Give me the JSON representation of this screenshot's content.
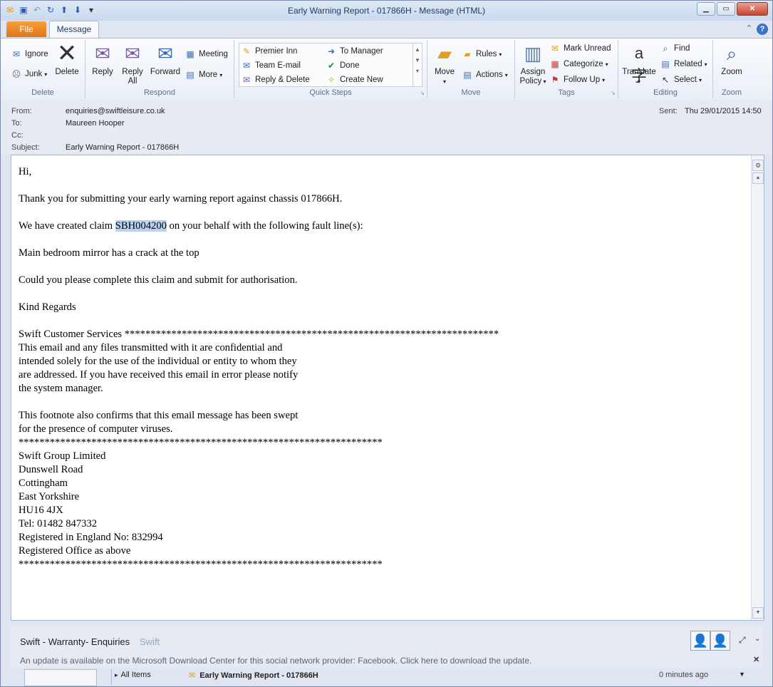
{
  "window": {
    "title": "Early Warning Report - 017866H  -  Message (HTML)"
  },
  "qat": {
    "icons": [
      "mail-icon",
      "save-icon",
      "undo-icon",
      "redo-icon",
      "up-arrow-icon",
      "down-arrow-icon",
      "customize-icon"
    ]
  },
  "tabs": {
    "file": "File",
    "message": "Message"
  },
  "ribbon": {
    "delete_group": {
      "label": "Delete",
      "ignore": "Ignore",
      "junk": "Junk",
      "delete": "Delete"
    },
    "respond_group": {
      "label": "Respond",
      "reply": "Reply",
      "reply_all_1": "Reply",
      "reply_all_2": "All",
      "forward": "Forward",
      "meeting": "Meeting",
      "more": "More"
    },
    "quick_steps_group": {
      "label": "Quick Steps",
      "premier_inn": "Premier Inn",
      "team_email": "Team E-mail",
      "reply_delete": "Reply & Delete",
      "to_manager": "To Manager",
      "done": "Done",
      "create_new": "Create New"
    },
    "move_group": {
      "label": "Move",
      "move": "Move",
      "rules": "Rules",
      "actions": "Actions"
    },
    "tags_group": {
      "label": "Tags",
      "assign_policy_1": "Assign",
      "assign_policy_2": "Policy",
      "mark_unread": "Mark Unread",
      "categorize": "Categorize",
      "follow_up": "Follow Up"
    },
    "editing_group": {
      "label": "Editing",
      "translate": "Translate",
      "find": "Find",
      "related": "Related",
      "select": "Select"
    },
    "zoom_group": {
      "label": "Zoom",
      "zoom": "Zoom"
    }
  },
  "header": {
    "from_label": "From:",
    "from_value": "enquiries@swiftleisure.co.uk",
    "to_label": "To:",
    "to_value": "Maureen Hooper",
    "cc_label": "Cc:",
    "subject_label": "Subject:",
    "subject_value": "Early Warning Report - 017866H",
    "sent_label": "Sent:",
    "sent_value": "Thu 29/01/2015 14:50"
  },
  "body": {
    "greeting": "Hi,",
    "line1": "Thank you for submitting your early warning report against chassis 017866H.",
    "line2_pre": "We have created claim ",
    "claim_id": "SBH004200",
    "line2_post": " on your behalf with the following fault line(s):",
    "fault": "Main bedroom mirror has a crack at the top",
    "request": "Could you please complete this claim and submit for authorisation.",
    "regards": "Kind Regards",
    "sig_line": "Swift Customer Services ************************************************************************",
    "disclaimer": [
      "This email and any files transmitted with it are confidential and",
      "intended solely for the use of the individual or entity to whom they",
      "are addressed. If you have received this email in error please notify",
      "the system manager."
    ],
    "footnote": [
      "This footnote also confirms that this email message has been swept",
      "for the presence of computer viruses."
    ],
    "stars": "**********************************************************************",
    "address": [
      "Swift Group Limited",
      "Dunswell Road",
      "Cottingham",
      "East Yorkshire",
      "HU16 4JX",
      "Tel: 01482 847332",
      "Registered in England No: 832994",
      "Registered Office as above"
    ]
  },
  "people_pane": {
    "name": "Swift - Warranty- Enquiries",
    "company": "Swift",
    "notice": "An update is available on the Microsoft Download Center for this social network provider: Facebook. Click here to download the update."
  },
  "bottom_strip": {
    "all_items": "All Items",
    "message_subject": "Early Warning Report - 017866H",
    "time": "0 minutes ago"
  },
  "colors": {
    "file_tab": "#e0731b",
    "highlight": "#b8d3f2",
    "close_button": "#c7442d"
  }
}
